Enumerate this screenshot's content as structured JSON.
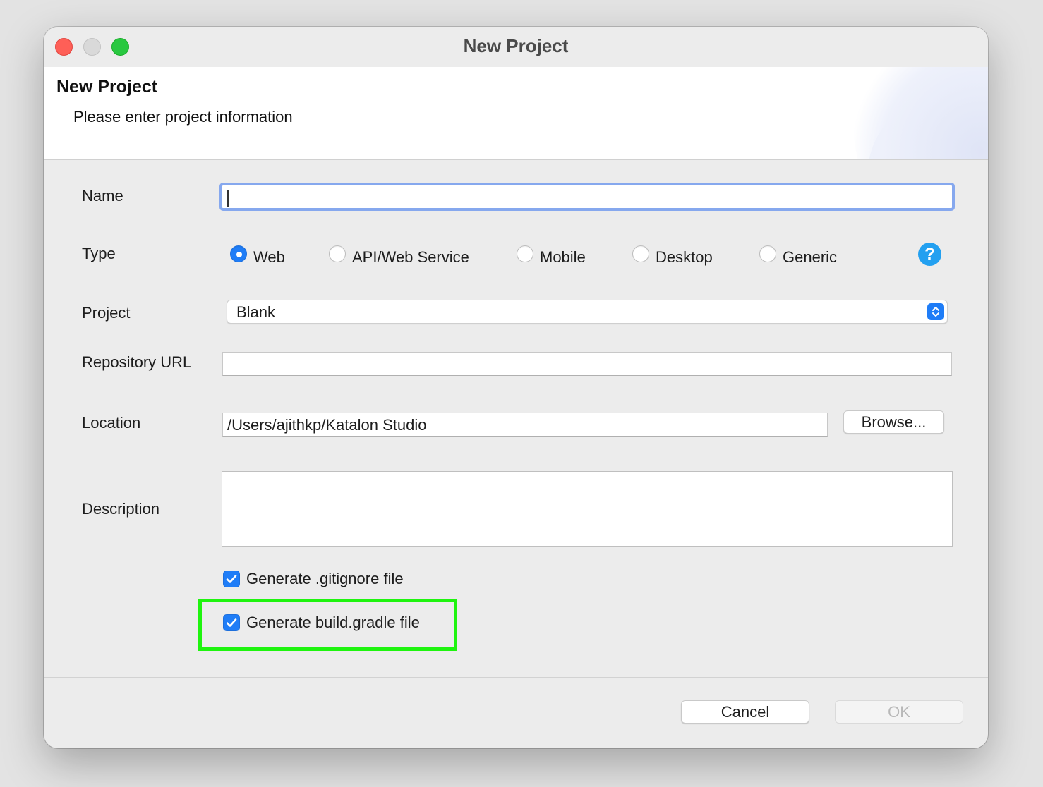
{
  "window": {
    "title": "New Project"
  },
  "banner": {
    "title": "New Project",
    "subtitle": "Please enter project information"
  },
  "form": {
    "name": {
      "label": "Name",
      "value": ""
    },
    "type": {
      "label": "Type",
      "options": [
        "Web",
        "API/Web Service",
        "Mobile",
        "Desktop",
        "Generic"
      ],
      "selected": "Web"
    },
    "project": {
      "label": "Project",
      "value": "Blank"
    },
    "repository": {
      "label": "Repository URL",
      "value": ""
    },
    "location": {
      "label": "Location",
      "value": "/Users/ajithkp/Katalon Studio",
      "browse_label": "Browse..."
    },
    "description": {
      "label": "Description",
      "value": ""
    },
    "gitignore": {
      "label": "Generate .gitignore file",
      "checked": true
    },
    "gradle": {
      "label": "Generate build.gradle file",
      "checked": true
    }
  },
  "footer": {
    "cancel_label": "Cancel",
    "ok_label": "OK"
  },
  "colors": {
    "accent": "#1f7df7",
    "highlight": "#1ff40f",
    "help": "#23a0f0"
  },
  "icons": {
    "help": "question-mark-circle-icon",
    "checkbox": "checkmark-icon",
    "select": "up-down-chevron-icon"
  }
}
